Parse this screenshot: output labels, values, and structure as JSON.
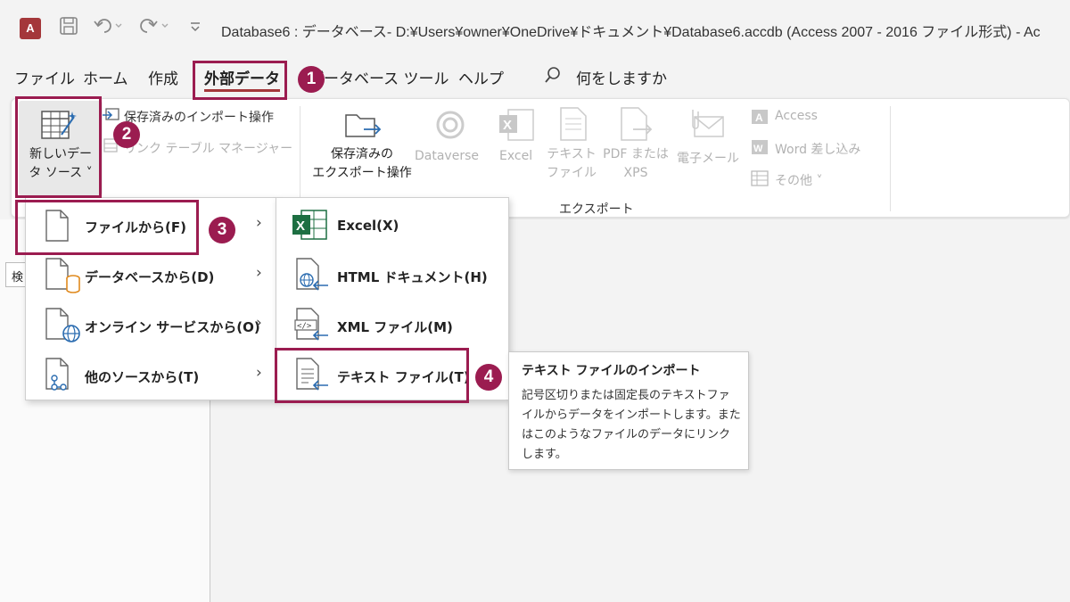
{
  "window": {
    "app_icon": "A",
    "title": "Database6 : データベース- D:¥Users¥owner¥OneDrive¥ドキュメント¥Database6.accdb (Access 2007 - 2016 ファイル形式)  -  Ac"
  },
  "tabs": [
    {
      "label": "ファイル"
    },
    {
      "label": "ホーム"
    },
    {
      "label": "作成"
    },
    {
      "label": "外部データ",
      "active": true
    },
    {
      "label": "データベース ツール"
    },
    {
      "label": "ヘルプ"
    }
  ],
  "search": {
    "label": "何をしますか",
    "icon": "search-icon"
  },
  "ribbon": {
    "new_data_source": "新しいデータ ソース",
    "new_data_source_lines": [
      "新しいデー",
      "タ ソース ˅"
    ],
    "saved_imports": "保存済みのインポート操作",
    "linked_table_manager": "リンク テーブル マネージャー",
    "saved_exports_lines": [
      "保存済みの",
      "エクスポート操作"
    ],
    "dataverse": "Dataverse",
    "excel": "Excel",
    "text_file_lines": [
      "テキスト",
      "ファイル"
    ],
    "pdf_xps_lines": [
      "PDF または",
      "XPS"
    ],
    "email": "電子メール",
    "access": "Access",
    "word_merge": "Word 差し込み",
    "other": "その他 ˅",
    "export_group": "エクスポート"
  },
  "nav_pane": {
    "partial_label": "検"
  },
  "menu1": {
    "items": [
      {
        "label": "ファイルから(F)",
        "name": "from-file"
      },
      {
        "label": "データベースから(D)",
        "name": "from-database"
      },
      {
        "label": "オンライン サービスから(O)",
        "name": "from-online-services"
      },
      {
        "label": "他のソースから(T)",
        "name": "from-other-sources"
      }
    ]
  },
  "menu2": {
    "items": [
      {
        "label": "Excel(X)",
        "name": "excel"
      },
      {
        "label": "HTML ドキュメント(H)",
        "name": "html-document"
      },
      {
        "label": "XML ファイル(M)",
        "name": "xml-file"
      },
      {
        "label": "テキスト ファイル(T)",
        "name": "text-file"
      }
    ]
  },
  "tooltip": {
    "title": "テキスト ファイルのインポート",
    "body": "記号区切りまたは固定長のテキストファイルからデータをインポートします。またはこのようなファイルのデータにリンクします。"
  },
  "steps": {
    "s1": "1",
    "s2": "2",
    "s3": "3",
    "s4": "4"
  },
  "colors": {
    "accent": "#9b1c50",
    "access_brand": "#a4373a",
    "excel_green": "#1d6f42"
  }
}
